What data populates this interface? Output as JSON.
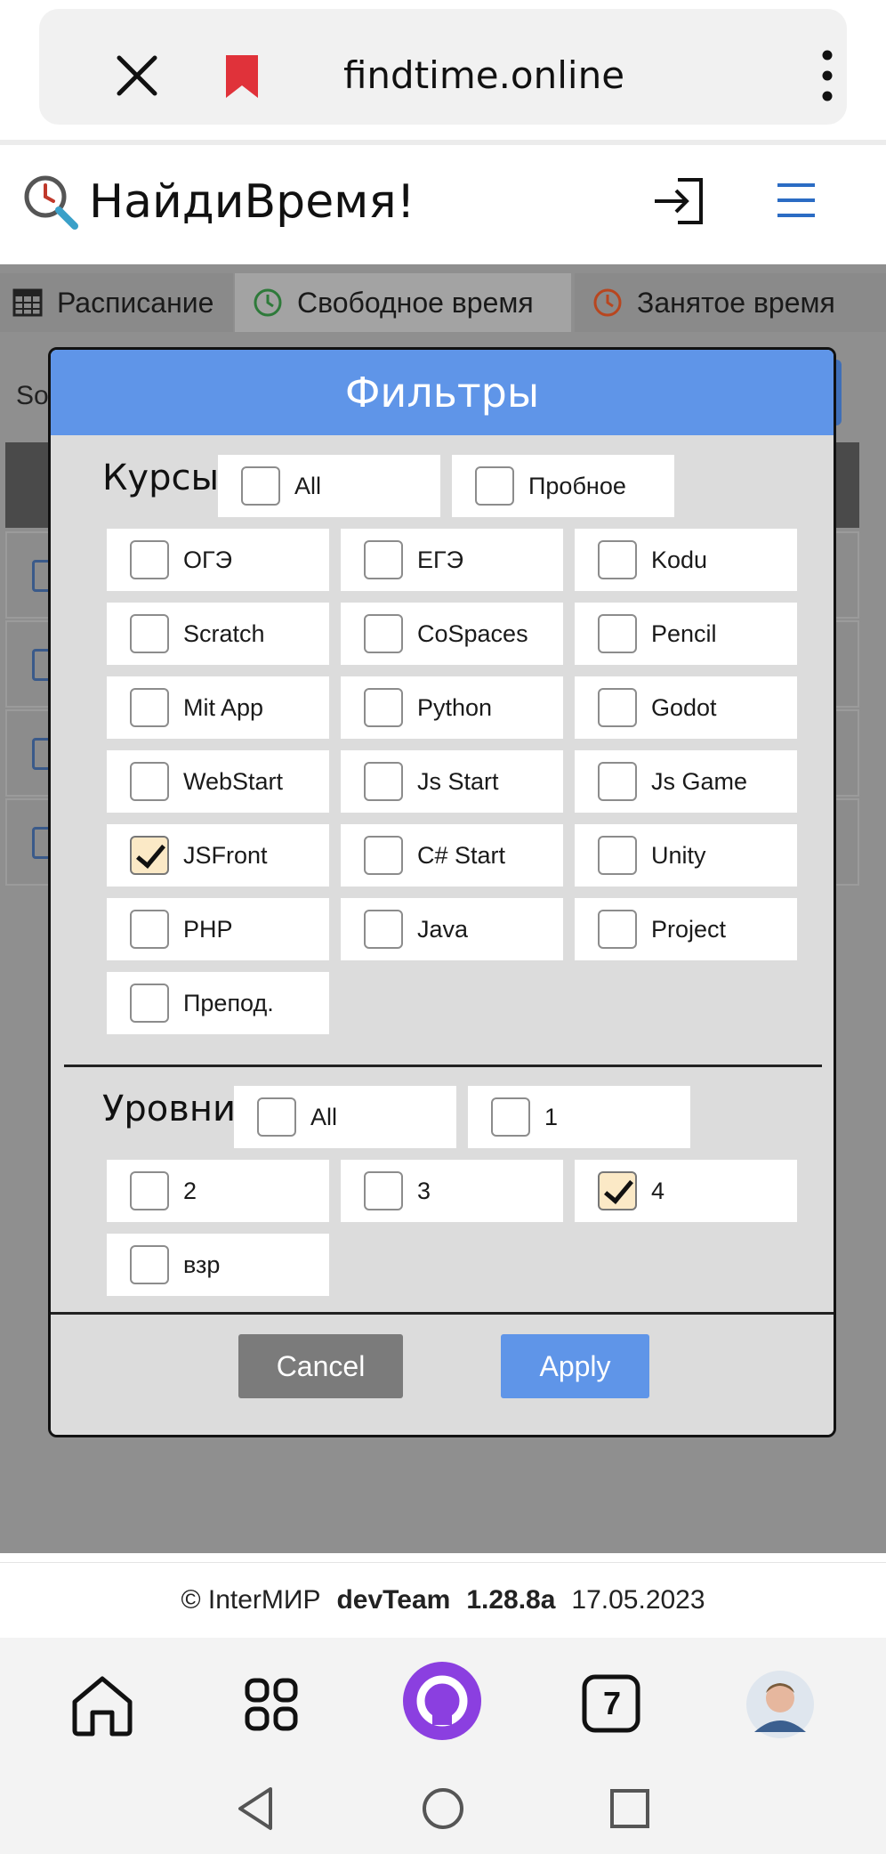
{
  "browser": {
    "url": "findtime.online",
    "tab_count": "7"
  },
  "app": {
    "title": "НайдиВремя!"
  },
  "tabs": [
    {
      "label": "Расписание"
    },
    {
      "label": "Свободное время"
    },
    {
      "label": "Занятое время"
    }
  ],
  "background": {
    "sort_label": "So"
  },
  "modal": {
    "title": "Фильтры",
    "courses": {
      "title": "Курсы",
      "options": [
        {
          "label": "All",
          "checked": false
        },
        {
          "label": "Пробное",
          "checked": false
        },
        {
          "label": "ОГЭ",
          "checked": false
        },
        {
          "label": "ЕГЭ",
          "checked": false
        },
        {
          "label": "Kodu",
          "checked": false
        },
        {
          "label": "Scratch",
          "checked": false
        },
        {
          "label": "CoSpaces",
          "checked": false
        },
        {
          "label": "Pencil",
          "checked": false
        },
        {
          "label": "Mit App",
          "checked": false
        },
        {
          "label": "Python",
          "checked": false
        },
        {
          "label": "Godot",
          "checked": false
        },
        {
          "label": "WebStart",
          "checked": false
        },
        {
          "label": "Js Start",
          "checked": false
        },
        {
          "label": "Js Game",
          "checked": false
        },
        {
          "label": "JSFront",
          "checked": true
        },
        {
          "label": "C# Start",
          "checked": false
        },
        {
          "label": "Unity",
          "checked": false
        },
        {
          "label": "PHP",
          "checked": false
        },
        {
          "label": "Java",
          "checked": false
        },
        {
          "label": "Project",
          "checked": false
        },
        {
          "label": "Препод.",
          "checked": false
        }
      ]
    },
    "levels": {
      "title": "Уровни",
      "options": [
        {
          "label": "All",
          "checked": false
        },
        {
          "label": "1",
          "checked": false
        },
        {
          "label": "2",
          "checked": false
        },
        {
          "label": "3",
          "checked": false
        },
        {
          "label": "4",
          "checked": true
        },
        {
          "label": "взр",
          "checked": false
        }
      ]
    },
    "cancel_label": "Cancel",
    "apply_label": "Apply"
  },
  "footer": {
    "copyright": "© InterМИР",
    "team": "devTeam",
    "version": "1.28.8a",
    "date": "17.05.2023"
  },
  "colors": {
    "accent": "#5f95e8",
    "overlay": "#8f8f8f",
    "checked_box": "#fbe9c6",
    "bookmark": "#e0323a",
    "alice": "#8b3fe0"
  },
  "icons": [
    "close-icon",
    "bookmark-icon",
    "more-vertical-icon",
    "clock-search-icon",
    "login-icon",
    "hamburger-icon",
    "table-icon",
    "clock-green-icon",
    "clock-red-icon",
    "home-icon",
    "apps-icon",
    "alice-icon",
    "tabs-icon",
    "avatar",
    "back-icon",
    "home-circle-icon",
    "recents-icon"
  ]
}
